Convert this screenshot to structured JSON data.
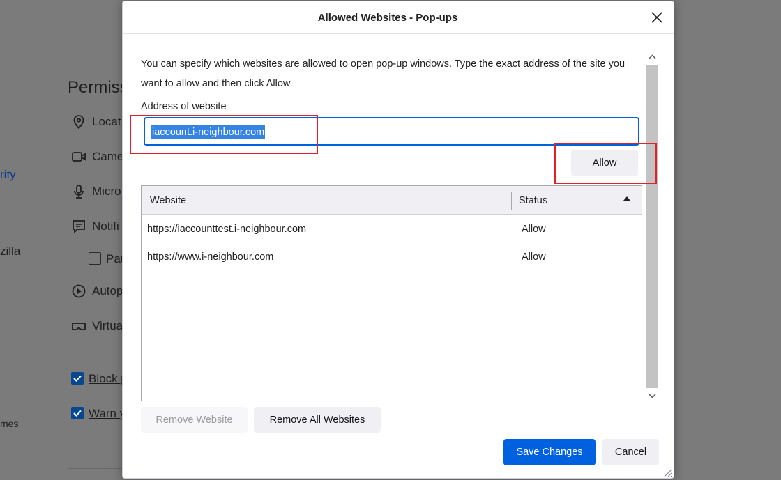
{
  "background": {
    "heading": "Permiss",
    "sidebar_link": "rity",
    "sidebar_text_1": "zilla",
    "sidebar_text_2": "mes",
    "permissions": [
      {
        "label": "Locat",
        "icon": "location-pin-icon"
      },
      {
        "label": "Came",
        "icon": "camera-icon"
      },
      {
        "label": "Micro",
        "icon": "microphone-icon"
      },
      {
        "label": "Notifi",
        "icon": "notification-icon"
      },
      {
        "label": "Pau",
        "icon": "checkbox-unchecked"
      },
      {
        "label": "Autop",
        "icon": "autoplay-icon"
      },
      {
        "label": "Virtua",
        "icon": "vr-headset-icon"
      }
    ],
    "block_popups_label": "Block p",
    "warn_label": "Warn y"
  },
  "dialog": {
    "title": "Allowed Websites - Pop-ups",
    "description": "You can specify which websites are allowed to open pop-up windows. Type the exact address of the site you want to allow and then click Allow.",
    "address_label": "Address of website",
    "address_value": "iaccount.i-neighbour.com",
    "allow_button": "Allow",
    "table": {
      "columns": [
        "Website",
        "Status"
      ],
      "rows": [
        {
          "website": "https://iaccounttest.i-neighbour.com",
          "status": "Allow"
        },
        {
          "website": "https://www.i-neighbour.com",
          "status": "Allow"
        }
      ]
    },
    "remove_website_button": "Remove Website",
    "remove_all_button": "Remove All Websites",
    "save_button": "Save Changes",
    "cancel_button": "Cancel"
  },
  "colors": {
    "accent": "#0061e0",
    "highlight": "#e0202a",
    "selection": "#3584e4"
  }
}
